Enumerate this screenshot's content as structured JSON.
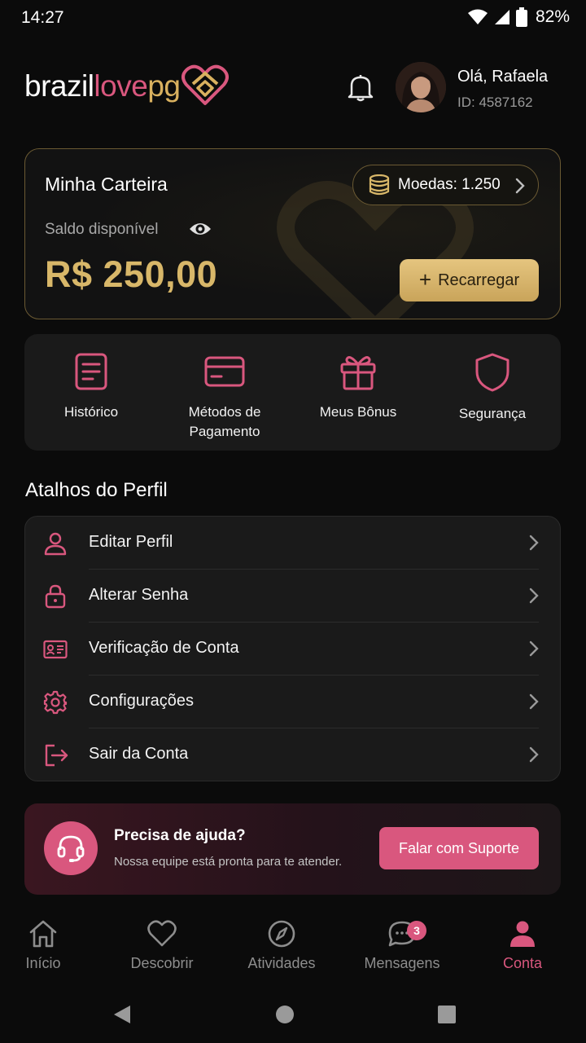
{
  "status_bar": {
    "time": "14:27",
    "battery": "82%"
  },
  "header": {
    "logo": {
      "part1": "brazil",
      "part2": "love",
      "part3": "pg"
    },
    "greeting": "Olá, Rafaela",
    "user_id": "ID: 4587162"
  },
  "wallet": {
    "title": "Minha Carteira",
    "coins": "Moedas: 1.250",
    "balance_label": "Saldo disponível",
    "balance": "R$ 250,00",
    "recharge_label": "Recarregar"
  },
  "quick_actions": [
    {
      "label": "Histórico",
      "icon": "document-icon"
    },
    {
      "label": "Métodos de Pagamento",
      "icon": "credit-card-icon"
    },
    {
      "label": "Meus Bônus",
      "icon": "gift-icon"
    },
    {
      "label": "Segurança",
      "icon": "shield-icon"
    }
  ],
  "shortcuts": {
    "title": "Atalhos do Perfil",
    "items": [
      {
        "label": "Editar Perfil",
        "icon": "user-icon"
      },
      {
        "label": "Alterar Senha",
        "icon": "lock-icon"
      },
      {
        "label": "Verificação de Conta",
        "icon": "id-card-icon"
      },
      {
        "label": "Configurações",
        "icon": "gear-icon"
      },
      {
        "label": "Sair da Conta",
        "icon": "logout-icon"
      }
    ]
  },
  "help": {
    "title": "Precisa de ajuda?",
    "subtitle": "Nossa equipe está pronta para te atender.",
    "button": "Falar com Suporte"
  },
  "bottom_nav": {
    "items": [
      {
        "label": "Início",
        "icon": "home-icon"
      },
      {
        "label": "Descobrir",
        "icon": "heart-icon"
      },
      {
        "label": "Atividades",
        "icon": "compass-icon"
      },
      {
        "label": "Mensagens",
        "icon": "chat-icon",
        "badge": "3"
      },
      {
        "label": "Conta",
        "icon": "person-icon",
        "active": true
      }
    ]
  },
  "colors": {
    "accent_pink": "#d9577e",
    "accent_gold": "#d8b769",
    "background": "#0b0b0b",
    "card": "#1a1a1a"
  }
}
